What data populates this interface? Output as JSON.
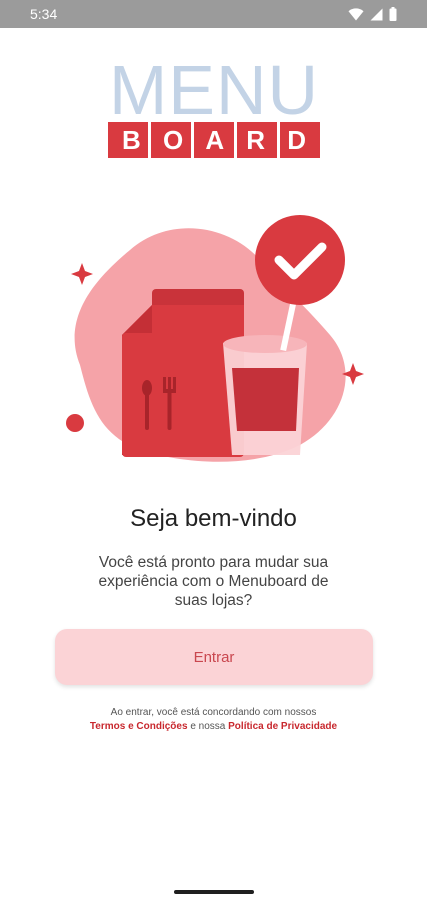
{
  "status_bar": {
    "time": "5:34"
  },
  "logo": {
    "top_text": "MENU",
    "bottom_letters": [
      "B",
      "O",
      "A",
      "R",
      "D"
    ]
  },
  "colors": {
    "primary_red": "#d93a40",
    "light_pink": "#fbd3d6",
    "logo_blue": "#c3d3e6",
    "link_red": "#c8282e"
  },
  "welcome": {
    "title": "Seja bem-vindo",
    "message": "Você está pronto para mudar sua experiência com o Menuboard de suas lojas?"
  },
  "enter_button": {
    "label": "Entrar"
  },
  "legal": {
    "line1": "Ao entrar, você está concordando com nossos",
    "terms_link": "Termos e Condições",
    "connector": "e nossa",
    "privacy_link": "Política de Privacidade"
  }
}
